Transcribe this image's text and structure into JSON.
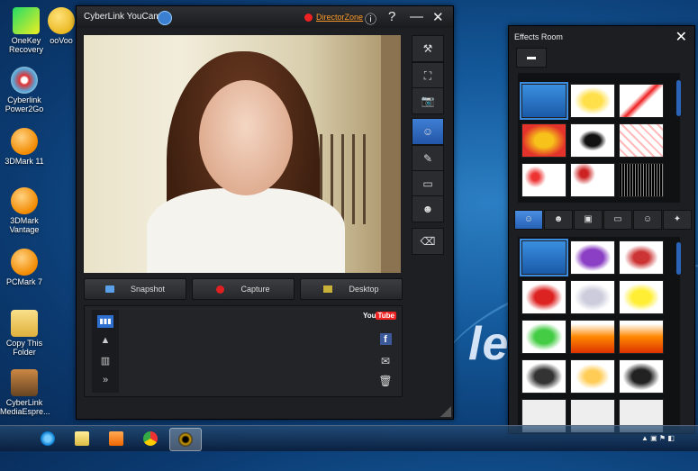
{
  "desktop": {
    "brand_text": "le",
    "icons": [
      {
        "label": "OneKey\nRecovery",
        "icon": "onekey-icon"
      },
      {
        "label": "ooVoo",
        "icon": "oovoo-icon"
      },
      {
        "label": "Cyberlink\nPower2Go",
        "icon": "power2go-icon"
      },
      {
        "label": "3DMark 11",
        "icon": "3dmark-icon"
      },
      {
        "label": "3DMark\nVantage",
        "icon": "3dmark-icon"
      },
      {
        "label": "PCMark 7",
        "icon": "pcmark-icon"
      },
      {
        "label": "Copy This\nFolder",
        "icon": "folder-icon"
      },
      {
        "label": "CyberLink\nMediaEspre...",
        "icon": "mediaespresso-icon"
      }
    ]
  },
  "youcam": {
    "title": "CyberLink YouCam",
    "director_zone": "DirectorZone",
    "buttons": {
      "snapshot": "Snapshot",
      "capture": "Capture",
      "desktop": "Desktop"
    },
    "youtube": "You",
    "youtube_tube": "Tube",
    "facebook": "f",
    "colors": {
      "capture_dot": "#e02020",
      "accent": "#2e6fd0"
    }
  },
  "effects_room": {
    "title": "Effects Room",
    "tabs": [
      "avatar-tab",
      "emotion-tab",
      "frame-tab",
      "scene-tab",
      "face-tab",
      "magic-tab"
    ]
  },
  "taskbar": {
    "apps": [
      "internet-explorer-icon",
      "explorer-icon",
      "media-player-icon",
      "chrome-icon",
      "youcam-icon"
    ]
  }
}
